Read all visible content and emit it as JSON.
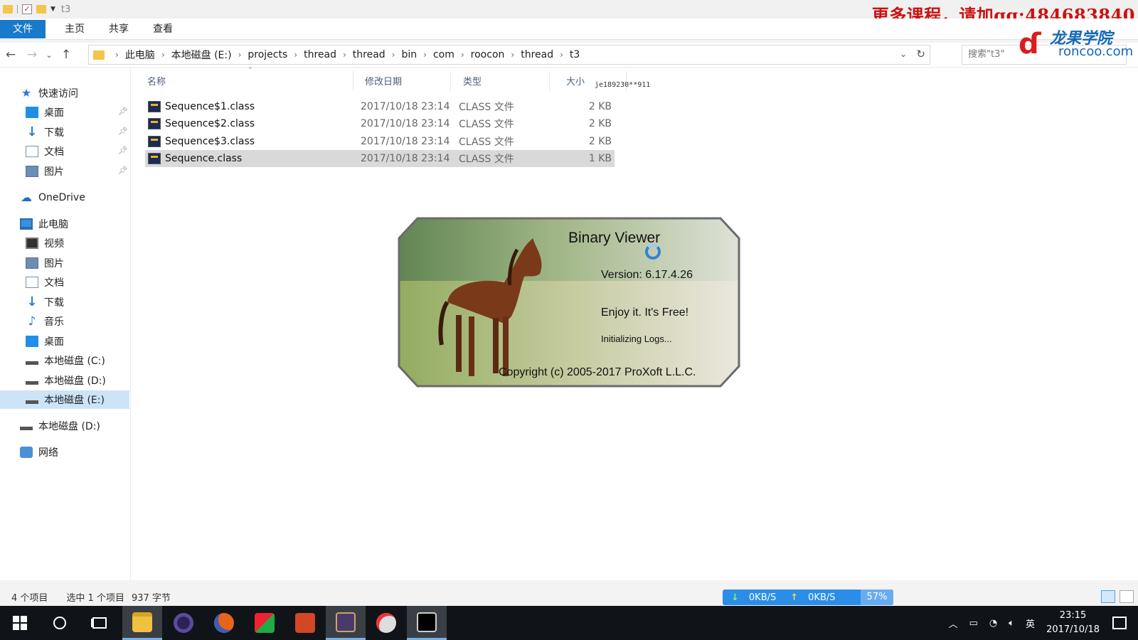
{
  "window": {
    "title": "t3"
  },
  "promo": {
    "text": "更多课程，请加qq:484683840"
  },
  "logo": {
    "cn": "龙果学院",
    "en": "roncoo.com"
  },
  "ribbon": {
    "tabs": [
      "文件",
      "主页",
      "共享",
      "查看"
    ]
  },
  "address": {
    "crumbs": [
      "此电脑",
      "本地磁盘 (E:)",
      "projects",
      "thread",
      "thread",
      "bin",
      "com",
      "roocon",
      "thread",
      "t3"
    ]
  },
  "search": {
    "placeholder": "搜索\"t3\""
  },
  "nav": {
    "quick_access": "快速访问",
    "quick_items": [
      "桌面",
      "下载",
      "文档",
      "图片"
    ],
    "onedrive": "OneDrive",
    "this_pc": "此电脑",
    "pc_items": [
      "视频",
      "图片",
      "文档",
      "下载",
      "音乐",
      "桌面",
      "本地磁盘 (C:)",
      "本地磁盘 (D:)",
      "本地磁盘 (E:)"
    ],
    "extra_drive": "本地磁盘 (D:)",
    "network": "网络"
  },
  "columns": {
    "name": "名称",
    "date": "修改日期",
    "type": "类型",
    "size": "大小"
  },
  "overlay_text": "je189230**911",
  "files": [
    {
      "name": "Sequence$1.class",
      "date": "2017/10/18 23:14",
      "type": "CLASS 文件",
      "size": "2 KB"
    },
    {
      "name": "Sequence$2.class",
      "date": "2017/10/18 23:14",
      "type": "CLASS 文件",
      "size": "2 KB"
    },
    {
      "name": "Sequence$3.class",
      "date": "2017/10/18 23:14",
      "type": "CLASS 文件",
      "size": "2 KB"
    },
    {
      "name": "Sequence.class",
      "date": "2017/10/18 23:14",
      "type": "CLASS 文件",
      "size": "1 KB"
    }
  ],
  "splash": {
    "title": "Binary Viewer",
    "version": "Version: 6.17.4.26",
    "tagline": "Enjoy it. It's Free!",
    "status": "Initializing Logs...",
    "copyright": "Copyright (c) 2005-2017 ProXoft L.L.C."
  },
  "status": {
    "count": "4 个项目",
    "selected": "选中 1 个项目",
    "size": "937 字节"
  },
  "netmon": {
    "down": "0KB/S",
    "up": "0KB/S",
    "percent": "57%"
  },
  "tray": {
    "ime": "英",
    "time": "23:15",
    "date": "2017/10/18"
  },
  "colors": {
    "accent": "#1979ca",
    "selection": "#d9d9d9",
    "taskbar": "#101418"
  }
}
